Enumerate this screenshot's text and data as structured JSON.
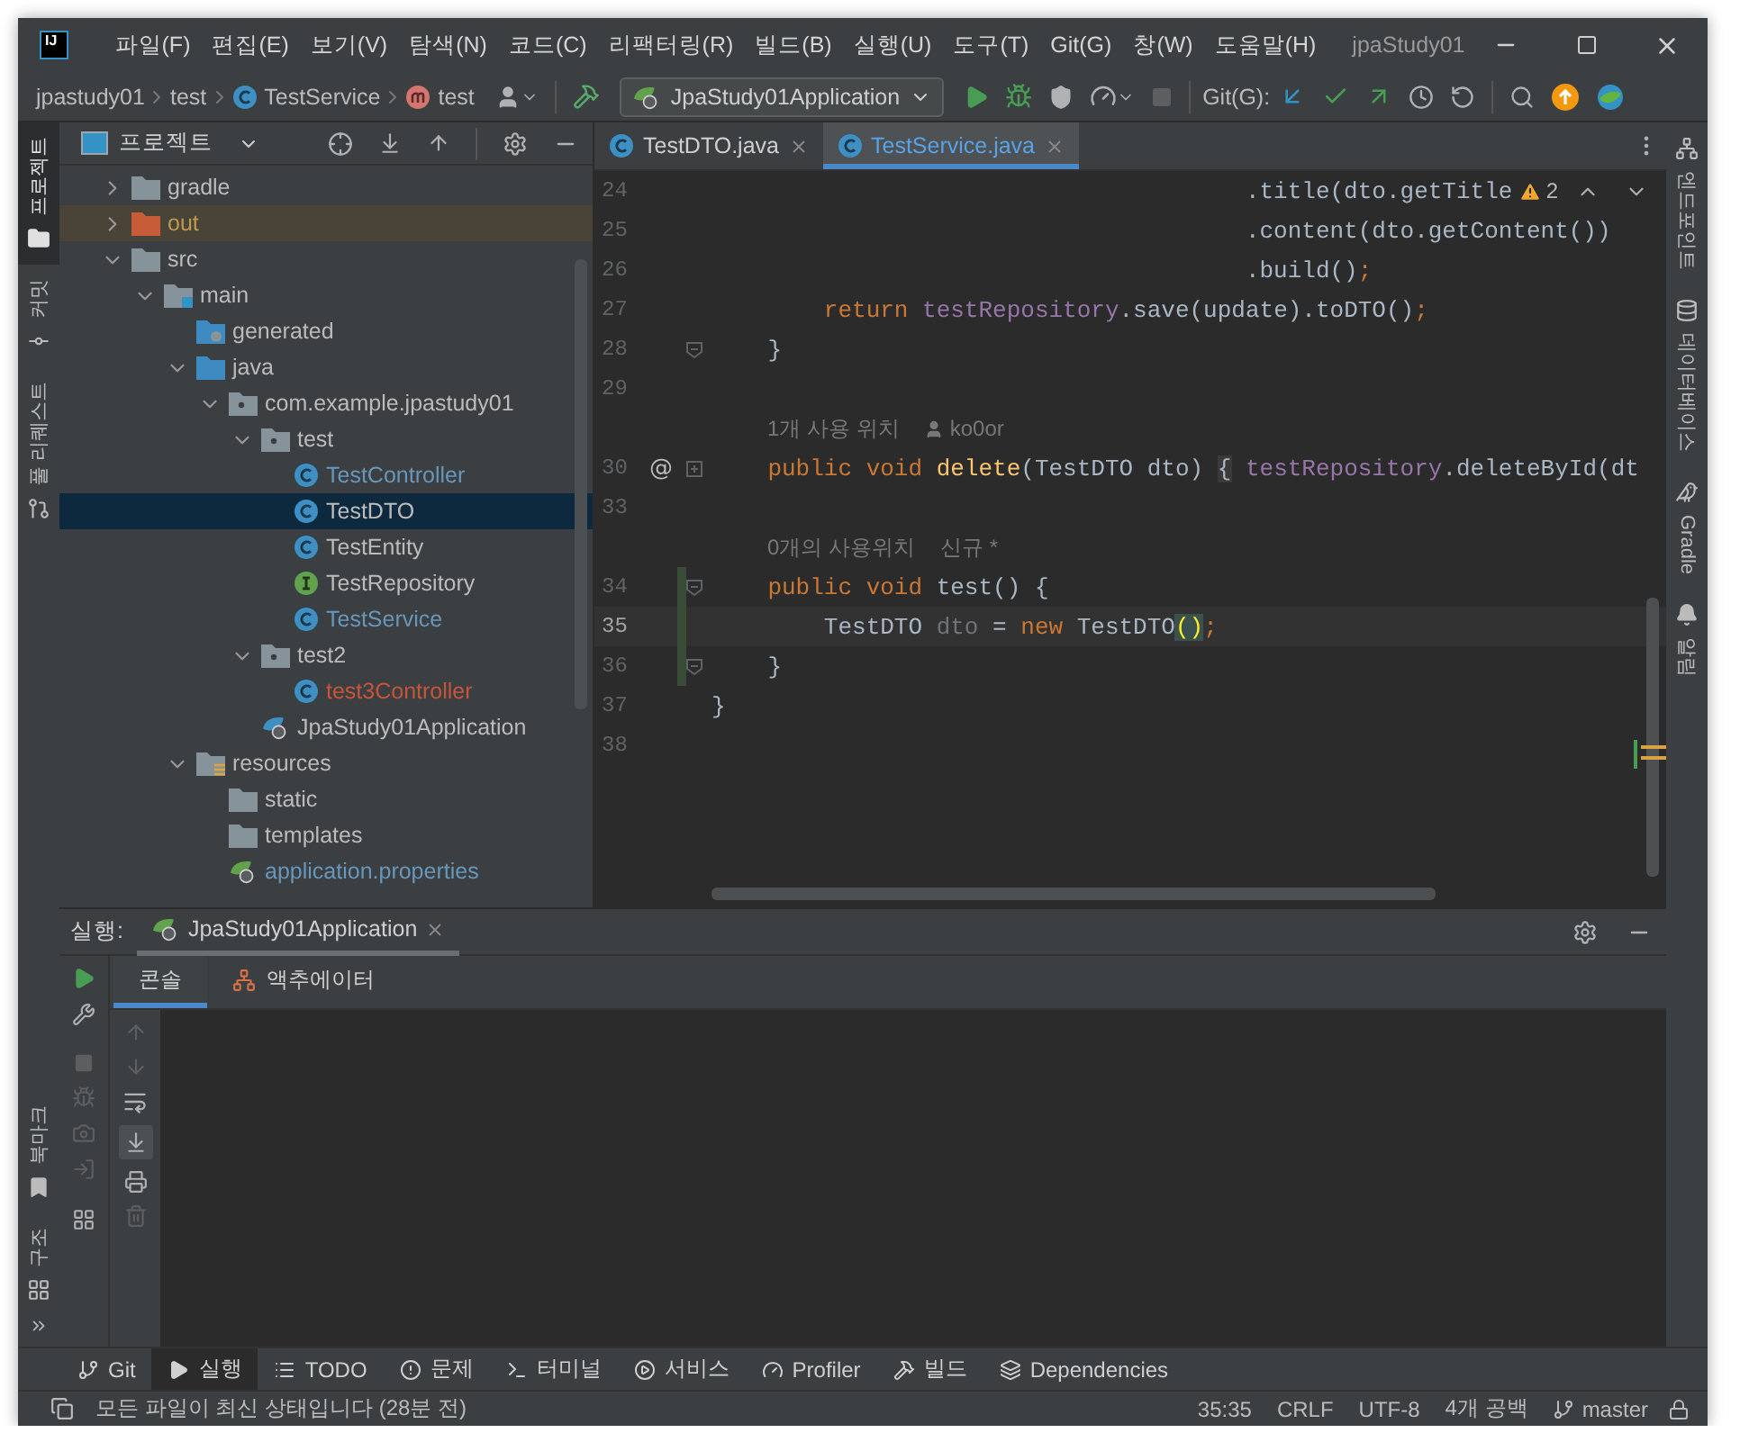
{
  "window": {
    "app_icon": "IJ",
    "title": "jpaStudy01"
  },
  "menu": [
    "파일(F)",
    "편집(E)",
    "보기(V)",
    "탐색(N)",
    "코드(C)",
    "리팩터링(R)",
    "빌드(B)",
    "실행(U)",
    "도구(T)",
    "Git(G)",
    "창(W)",
    "도움말(H)"
  ],
  "breadcrumbs": [
    {
      "label": "jpastudy01",
      "kind": "folder"
    },
    {
      "label": "test",
      "kind": "package"
    },
    {
      "label": "TestService",
      "kind": "class"
    },
    {
      "label": "test",
      "kind": "method"
    }
  ],
  "run_config": "JpaStudy01Application",
  "git_label": "Git(G):",
  "left_stripe_top": [
    {
      "label": "프로젝트",
      "kind": "project",
      "selected": true
    },
    {
      "label": "커밋",
      "kind": "commit",
      "selected": false
    },
    {
      "label": "풀 리퀘스트",
      "kind": "pull",
      "selected": false
    }
  ],
  "left_stripe_bottom": [
    {
      "label": "북마크",
      "kind": "bookmark",
      "selected": false
    },
    {
      "label": "구조",
      "kind": "structure",
      "selected": false
    }
  ],
  "right_stripe": [
    {
      "label": "엔드포인트",
      "kind": "endpoints",
      "selected": false
    },
    {
      "label": "데이터베이스",
      "kind": "database",
      "selected": false
    },
    {
      "label": "Gradle",
      "kind": "gradle",
      "selected": false
    },
    {
      "label": "알림",
      "kind": "bell",
      "selected": false
    }
  ],
  "project": {
    "title": "프로젝트",
    "tree": [
      {
        "label": "gradle",
        "kind": "folder",
        "color": "#bbbbbb",
        "selected": false,
        "expanded": false
      },
      {
        "label": "out",
        "kind": "excluded",
        "color": "#c09a4c",
        "selected": false,
        "expanded": false
      },
      {
        "label": "src",
        "kind": "folder",
        "color": "#bbbbbb",
        "selected": false,
        "expanded": true,
        "children": [
          {
            "label": "main",
            "kind": "module",
            "color": "#bbbbbb",
            "selected": false,
            "expanded": true,
            "children": [
              {
                "label": "generated",
                "kind": "generated",
                "color": "#bbbbbb",
                "selected": false
              },
              {
                "label": "java",
                "kind": "source",
                "color": "#bbbbbb",
                "selected": false,
                "expanded": true,
                "children": [
                  {
                    "label": "com.example.jpastudy01",
                    "kind": "package",
                    "color": "#bbbbbb",
                    "selected": false,
                    "expanded": true,
                    "children": [
                      {
                        "label": "test",
                        "kind": "package",
                        "color": "#bbbbbb",
                        "selected": false,
                        "expanded": true,
                        "children": [
                          {
                            "label": "TestController",
                            "kind": "class",
                            "color": "#6897bb",
                            "selected": false
                          },
                          {
                            "label": "TestDTO",
                            "kind": "class",
                            "color": "#bbbbbb",
                            "selected": true
                          },
                          {
                            "label": "TestEntity",
                            "kind": "class",
                            "color": "#bbbbbb",
                            "selected": false
                          },
                          {
                            "label": "TestRepository",
                            "kind": "interface",
                            "color": "#bbbbbb",
                            "selected": false
                          },
                          {
                            "label": "TestService",
                            "kind": "class",
                            "color": "#6897bb",
                            "selected": false
                          }
                        ]
                      },
                      {
                        "label": "test2",
                        "kind": "package",
                        "color": "#bbbbbb",
                        "selected": false,
                        "expanded": true,
                        "children": [
                          {
                            "label": "test3Controller",
                            "kind": "class",
                            "color": "#c7553a",
                            "selected": false
                          }
                        ]
                      },
                      {
                        "label": "JpaStudy01Application",
                        "kind": "spring",
                        "color": "#bbbbbb",
                        "selected": false
                      }
                    ]
                  }
                ]
              },
              {
                "label": "resources",
                "kind": "resources",
                "color": "#bbbbbb",
                "selected": false,
                "expanded": true,
                "children": [
                  {
                    "label": "static",
                    "kind": "folder",
                    "color": "#bbbbbb",
                    "selected": false
                  },
                  {
                    "label": "templates",
                    "kind": "folder",
                    "color": "#bbbbbb",
                    "selected": false
                  },
                  {
                    "label": "application.properties",
                    "kind": "properties",
                    "color": "#6897bb",
                    "selected": false
                  }
                ]
              }
            ]
          }
        ]
      }
    ]
  },
  "editor": {
    "tabs": [
      {
        "label": "TestDTO.java",
        "selected": false
      },
      {
        "label": "TestService.java",
        "selected": true
      }
    ],
    "warnings": "2",
    "lines": [
      {
        "kind": "code",
        "number": "24",
        "current": false,
        "changed": false,
        "tokens": [
          {
            "kind": "plain",
            "text": "                                      .title(dto.getTitle"
          }
        ]
      },
      {
        "kind": "code",
        "number": "25",
        "current": false,
        "changed": false,
        "tokens": [
          {
            "kind": "plain",
            "text": "                                      .content(dto.getContent())"
          }
        ]
      },
      {
        "kind": "code",
        "number": "26",
        "current": false,
        "changed": false,
        "tokens": [
          {
            "kind": "plain",
            "text": "                                      .build()"
          },
          {
            "kind": "keyword",
            "text": ";"
          }
        ]
      },
      {
        "kind": "code",
        "number": "27",
        "current": false,
        "changed": false,
        "tokens": [
          {
            "kind": "keyword",
            "text": "        return "
          },
          {
            "kind": "field",
            "text": "testRepository"
          },
          {
            "kind": "plain",
            "text": ".save(update).toDTO()"
          },
          {
            "kind": "keyword",
            "text": ";"
          }
        ]
      },
      {
        "kind": "code",
        "number": "28",
        "current": false,
        "changed": false,
        "folded": false,
        "tokens": [
          {
            "kind": "plain",
            "text": "    }"
          }
        ]
      },
      {
        "kind": "code",
        "number": "29",
        "current": false,
        "changed": false
      },
      {
        "kind": "hint",
        "text": "1개 사용 위치",
        "author": "ko0or"
      },
      {
        "kind": "code",
        "number": "30",
        "current": false,
        "changed": false,
        "mark": "@",
        "folded": true,
        "tokens": [
          {
            "kind": "keyword",
            "text": "    public void "
          },
          {
            "kind": "method",
            "text": "delete"
          },
          {
            "kind": "plain",
            "text": "(TestDTO dto) "
          },
          {
            "kind": "folded",
            "text": "{"
          },
          {
            "kind": "field",
            "text": " testRepository"
          },
          {
            "kind": "plain",
            "text": ".deleteById(dt"
          }
        ]
      },
      {
        "kind": "code",
        "number": "33",
        "current": false,
        "changed": false
      },
      {
        "kind": "hint",
        "text": "0개의 사용위치",
        "extra": "신규 *"
      },
      {
        "kind": "code",
        "number": "34",
        "current": false,
        "changed": true,
        "folded": false,
        "tokens": [
          {
            "kind": "keyword",
            "text": "    public void "
          },
          {
            "kind": "unusedmethod",
            "text": "test"
          },
          {
            "kind": "plain",
            "text": "() {"
          }
        ]
      },
      {
        "kind": "code",
        "number": "35",
        "current": true,
        "changed": true,
        "tokens": [
          {
            "kind": "plain",
            "text": "        TestDTO "
          },
          {
            "kind": "unused",
            "text": "dto"
          },
          {
            "kind": "plain",
            "text": " = "
          },
          {
            "kind": "keyword",
            "text": "new"
          },
          {
            "kind": "plain",
            "text": " TestDTO"
          },
          {
            "kind": "match",
            "text": "()"
          },
          {
            "kind": "keyword",
            "text": ";"
          }
        ]
      },
      {
        "kind": "code",
        "number": "36",
        "current": false,
        "changed": true,
        "folded": false,
        "tokens": [
          {
            "kind": "plain",
            "text": "    }"
          }
        ]
      },
      {
        "kind": "code",
        "number": "37",
        "current": false,
        "changed": false,
        "tokens": [
          {
            "kind": "plain",
            "text": "}"
          }
        ]
      },
      {
        "kind": "code",
        "number": "38",
        "current": false,
        "changed": false
      }
    ]
  },
  "run": {
    "label": "실행:",
    "tab": "JpaStudy01Application",
    "subtabs": [
      {
        "label": "콘솔",
        "kind": "console",
        "selected": true
      },
      {
        "label": "액추에이터",
        "kind": "actuator",
        "selected": false
      }
    ]
  },
  "tool_windows": [
    {
      "label": "Git",
      "kind": "git",
      "selected": false
    },
    {
      "label": "실행",
      "kind": "run",
      "selected": true
    },
    {
      "label": "TODO",
      "kind": "todo",
      "selected": false
    },
    {
      "label": "문제",
      "kind": "problems",
      "selected": false
    },
    {
      "label": "터미널",
      "kind": "terminal",
      "selected": false
    },
    {
      "label": "서비스",
      "kind": "services",
      "selected": false
    },
    {
      "label": "Profiler",
      "kind": "profiler",
      "selected": false
    },
    {
      "label": "빌드",
      "kind": "build",
      "selected": false
    },
    {
      "label": "Dependencies",
      "kind": "dependencies",
      "selected": false
    }
  ],
  "status": {
    "message": "모든 파일이 최신 상태입니다 (28분 전)",
    "position": "35:35",
    "line_separator": "CRLF",
    "encoding": "UTF-8",
    "indent": "4개 공백",
    "branch": "master"
  }
}
